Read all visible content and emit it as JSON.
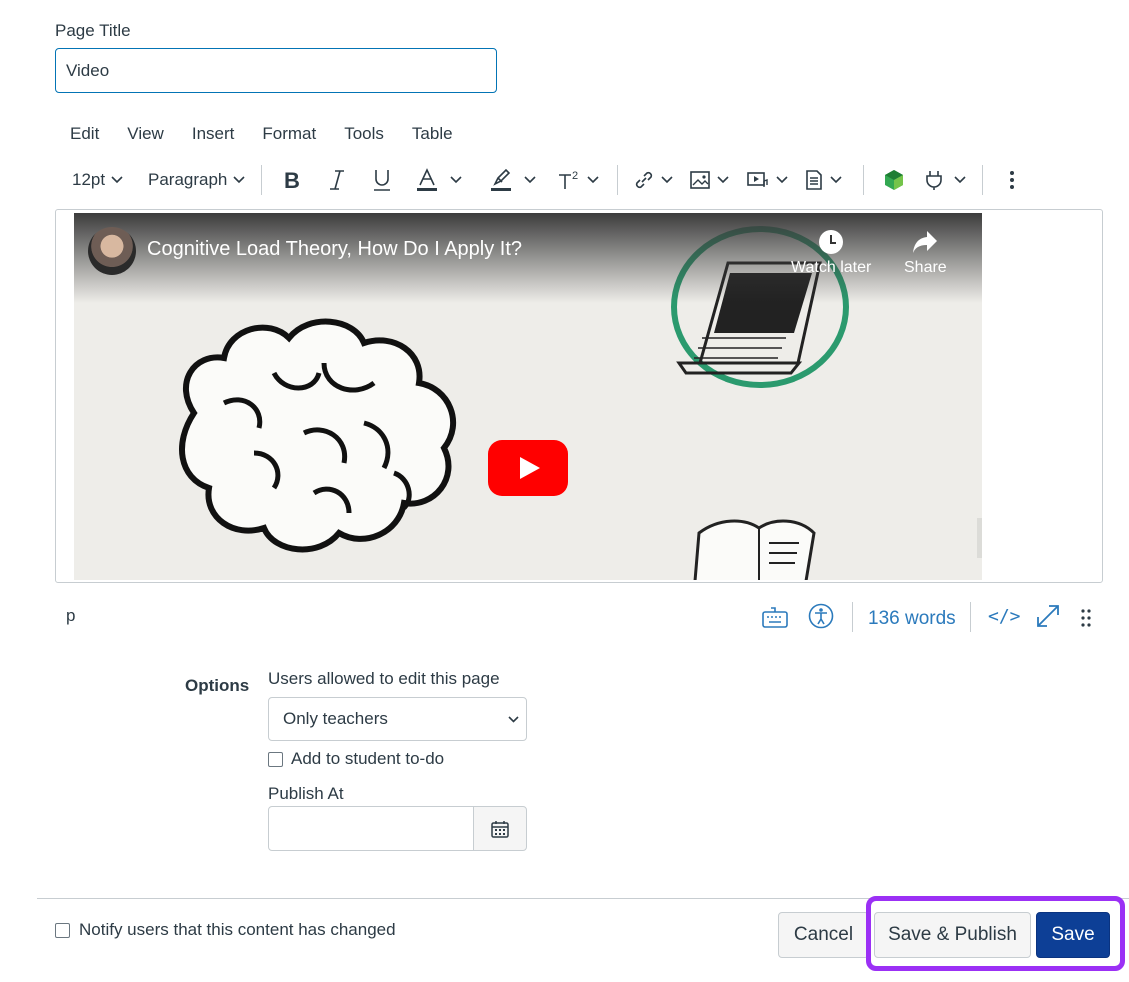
{
  "page_title": {
    "label": "Page Title",
    "value": "Video"
  },
  "menubar": [
    "Edit",
    "View",
    "Insert",
    "Format",
    "Tools",
    "Table"
  ],
  "toolbar": {
    "font_size": "12pt",
    "block_format": "Paragraph"
  },
  "video": {
    "title": "Cognitive Load Theory, How Do I Apply It?",
    "watch_later": "Watch later",
    "share": "Share"
  },
  "statusbar": {
    "path": "p",
    "word_count": "136 words",
    "html_toggle": "</>"
  },
  "options": {
    "label": "Options",
    "edit_permission_label": "Users allowed to edit this page",
    "edit_permission_value": "Only teachers",
    "todo_label": "Add to student to-do",
    "todo_checked": false,
    "publish_at_label": "Publish At",
    "publish_at_value": ""
  },
  "footer": {
    "notify_label": "Notify users that this content has changed",
    "notify_checked": false,
    "cancel_label": "Cancel",
    "save_publish_label": "Save & Publish",
    "save_label": "Save"
  },
  "colors": {
    "primary_button": "#0d3f96",
    "focus_border": "#0374b5",
    "highlight_outline": "#9b30f5",
    "link_blue": "#2b7abc"
  }
}
